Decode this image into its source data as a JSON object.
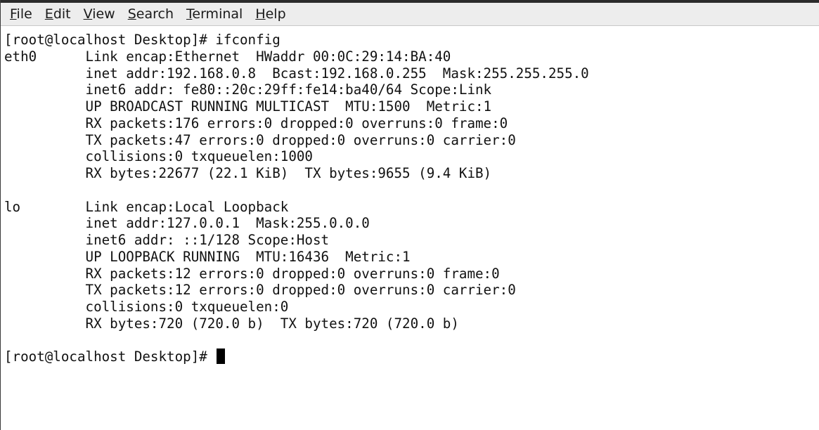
{
  "menubar": {
    "items": [
      {
        "rest": "ile",
        "mnemonic": "F"
      },
      {
        "rest": "dit",
        "mnemonic": "E"
      },
      {
        "rest": "iew",
        "mnemonic": "V"
      },
      {
        "rest": "earch",
        "mnemonic": "S"
      },
      {
        "rest": "erminal",
        "mnemonic": "T"
      },
      {
        "rest": "elp",
        "mnemonic": "H"
      }
    ]
  },
  "terminal": {
    "lines": [
      "[root@localhost Desktop]# ifconfig",
      "eth0      Link encap:Ethernet  HWaddr 00:0C:29:14:BA:40",
      "          inet addr:192.168.0.8  Bcast:192.168.0.255  Mask:255.255.255.0",
      "          inet6 addr: fe80::20c:29ff:fe14:ba40/64 Scope:Link",
      "          UP BROADCAST RUNNING MULTICAST  MTU:1500  Metric:1",
      "          RX packets:176 errors:0 dropped:0 overruns:0 frame:0",
      "          TX packets:47 errors:0 dropped:0 overruns:0 carrier:0",
      "          collisions:0 txqueuelen:1000",
      "          RX bytes:22677 (22.1 KiB)  TX bytes:9655 (9.4 KiB)",
      "",
      "lo        Link encap:Local Loopback",
      "          inet addr:127.0.0.1  Mask:255.0.0.0",
      "          inet6 addr: ::1/128 Scope:Host",
      "          UP LOOPBACK RUNNING  MTU:16436  Metric:1",
      "          RX packets:12 errors:0 dropped:0 overruns:0 frame:0",
      "          TX packets:12 errors:0 dropped:0 overruns:0 carrier:0",
      "          collisions:0 txqueuelen:0",
      "          RX bytes:720 (720.0 b)  TX bytes:720 (720.0 b)",
      ""
    ],
    "prompt": "[root@localhost Desktop]# "
  }
}
